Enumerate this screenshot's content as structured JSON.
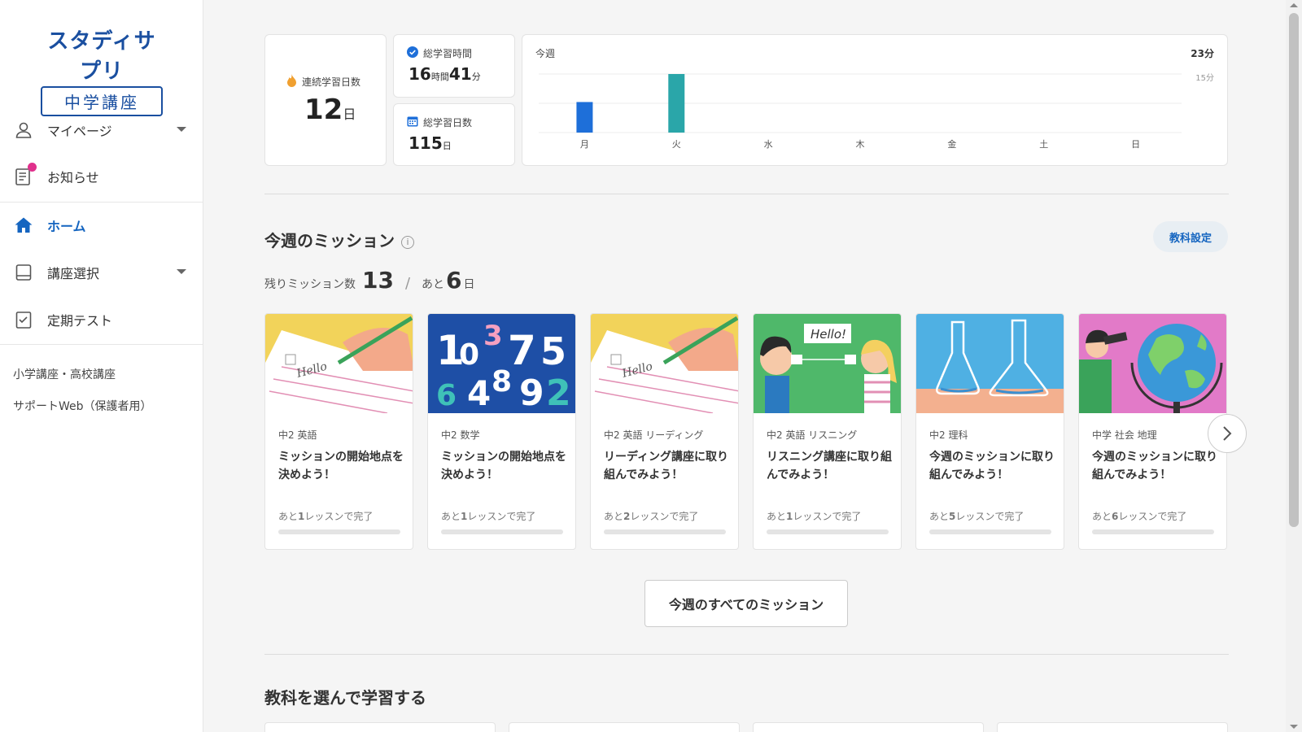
{
  "brand": {
    "line1": "スタディサプリ",
    "line2": "中学講座"
  },
  "nav": {
    "mypage": "マイページ",
    "news": "お知らせ",
    "home": "ホーム",
    "course": "講座選択",
    "test": "定期テスト",
    "link1": "小学講座・高校講座",
    "link2": "サポートWeb（保護者用）"
  },
  "stats": {
    "streak_label": "連続学習日数",
    "streak_value": "12",
    "streak_unit": "日",
    "time_label": "総学習時間",
    "time_hours": "16",
    "time_hours_unit": "時間",
    "time_minutes": "41",
    "time_minutes_unit": "分",
    "days_label": "総学習日数",
    "days_value": "115",
    "days_unit": "日"
  },
  "weekly": {
    "title": "今週",
    "max_label": "23分",
    "grid_label": "15分"
  },
  "chart_data": {
    "type": "bar",
    "categories": [
      "月",
      "火",
      "水",
      "木",
      "金",
      "土",
      "日"
    ],
    "values": [
      12,
      23,
      0,
      0,
      0,
      0,
      0
    ],
    "ylim": [
      0,
      23
    ],
    "colors": [
      "#1e6fd9",
      "#2aa6a9",
      "#2aa6a9",
      "#2aa6a9",
      "#2aa6a9",
      "#2aa6a9",
      "#2aa6a9"
    ],
    "grid": true
  },
  "missions": {
    "title": "今週のミッション",
    "info": "i",
    "settings": "教科設定",
    "remain_label": "残りミッション数",
    "remain_count": "13",
    "sep": "/",
    "days_prefix": "あと",
    "days_count": "6",
    "days_unit": "日",
    "all_button": "今週のすべてのミッション",
    "next_icon": "chevron-right-icon",
    "items": [
      {
        "subject": "中2 英語",
        "title": "ミッションの開始地点を決めよう！",
        "remain_prefix": "あと",
        "remain_n": "1",
        "remain_suffix": "レッスンで完了",
        "progress": 0,
        "img_text": "Hello"
      },
      {
        "subject": "中2 数学",
        "title": "ミッションの開始地点を決めよう！",
        "remain_prefix": "あと",
        "remain_n": "1",
        "remain_suffix": "レッスンで完了",
        "progress": 0
      },
      {
        "subject": "中2 英語 リーディング",
        "title": "リーディング講座に取り組んでみよう！",
        "remain_prefix": "あと",
        "remain_n": "2",
        "remain_suffix": "レッスンで完了",
        "progress": 0,
        "img_text": "Hello"
      },
      {
        "subject": "中2 英語 リスニング",
        "title": "リスニング講座に取り組んでみよう！",
        "remain_prefix": "あと",
        "remain_n": "1",
        "remain_suffix": "レッスンで完了",
        "progress": 0,
        "img_text": "Hello!"
      },
      {
        "subject": "中2 理科",
        "title": "今週のミッションに取り組んでみよう！",
        "remain_prefix": "あと",
        "remain_n": "5",
        "remain_suffix": "レッスンで完了",
        "progress": 0
      },
      {
        "subject": "中学 社会 地理",
        "title": "今週のミッションに取り組んでみよう！",
        "remain_prefix": "あと",
        "remain_n": "6",
        "remain_suffix": "レッスンで完了",
        "progress": 0
      }
    ]
  },
  "subjects": {
    "title": "教科を選んで学習する"
  },
  "colors": {
    "accent": "#1565c0",
    "bar_today": "#1e6fd9",
    "bar_other": "#2aa6a9",
    "badge": "#e0308c"
  }
}
